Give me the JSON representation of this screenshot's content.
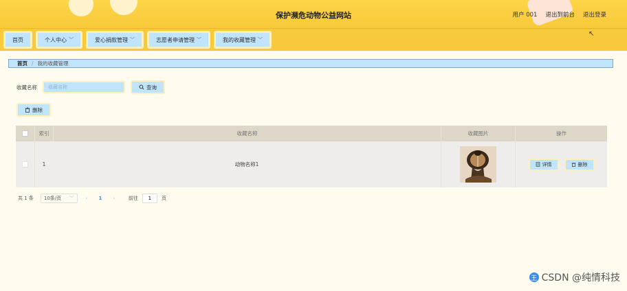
{
  "header": {
    "site_title": "保护濒危动物公益网站",
    "user_label": "用户 001",
    "back_to_front": "退出到前台",
    "logout": "退出登录"
  },
  "nav": {
    "items": [
      {
        "label": "首页",
        "has_dropdown": false
      },
      {
        "label": "个人中心",
        "has_dropdown": true
      },
      {
        "label": "爱心捐款管理",
        "has_dropdown": true
      },
      {
        "label": "志愿者申请管理",
        "has_dropdown": true
      },
      {
        "label": "我的收藏管理",
        "has_dropdown": true
      }
    ]
  },
  "breadcrumb": {
    "home": "首页",
    "separator": "/",
    "current": "我的收藏管理"
  },
  "search": {
    "label": "收藏名称",
    "placeholder": "收藏名称",
    "query_button": "查询"
  },
  "toolbar": {
    "delete_button": "删除"
  },
  "table": {
    "columns": [
      "索引",
      "收藏名称",
      "收藏图片",
      "操作"
    ],
    "rows": [
      {
        "index": "1",
        "name": "动物名称1",
        "image": "cobra-photo",
        "detail_label": "详情",
        "delete_label": "删除"
      }
    ]
  },
  "pagination": {
    "total": "共 1 条",
    "page_size": "10条/页",
    "prev": "‹",
    "current_page": "1",
    "next": "›",
    "goto_label": "前往",
    "goto_value": "1",
    "page_unit": "页"
  },
  "watermark": {
    "text": "CSDN @纯情科技",
    "badge": "王"
  },
  "colors": {
    "header_yellow": "#f8c93a",
    "button_blue": "#bfe4fb",
    "page_bg": "#fffbef",
    "table_header": "#dcd7c6",
    "link_blue": "#3a8ee6"
  }
}
